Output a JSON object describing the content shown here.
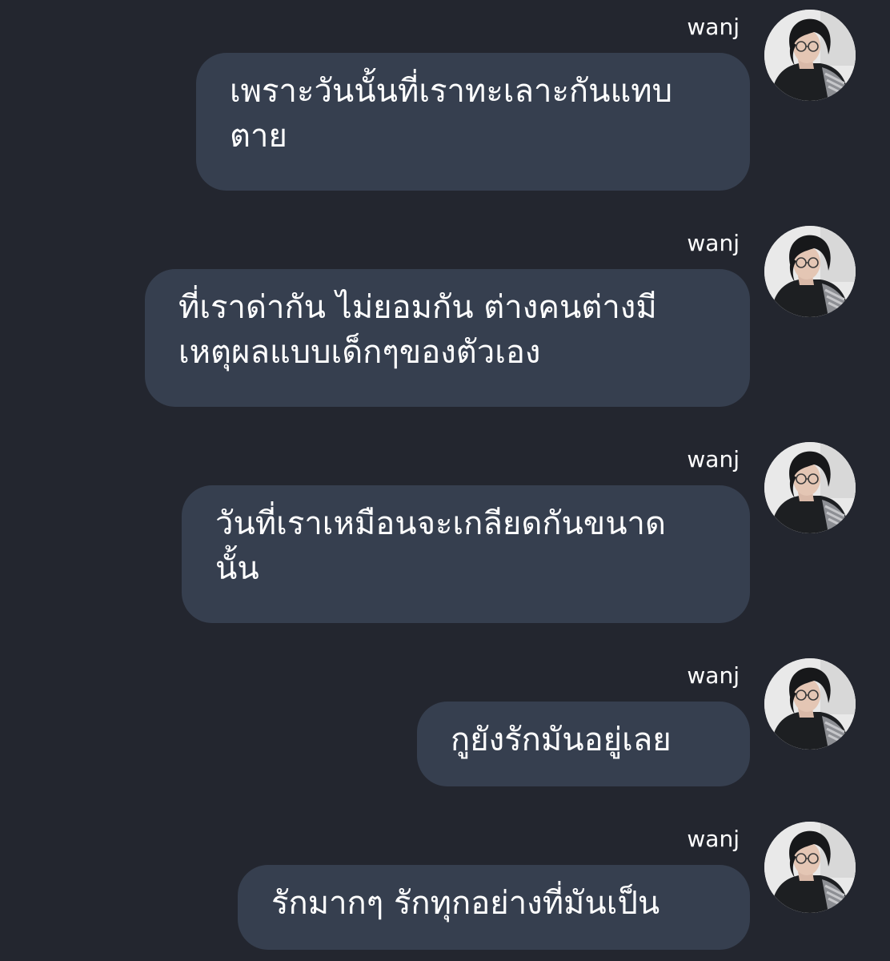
{
  "colors": {
    "background": "#23262f",
    "bubble": "#363f4f",
    "text": "#ffffff"
  },
  "messages": [
    {
      "sender": "wanj",
      "text": "เพราะวันนั้นที่เราทะเลาะกันแทบ\nตาย",
      "avatar_icon": "profile-photo"
    },
    {
      "sender": "wanj",
      "text": "ที่เราด่ากัน ไม่ยอมกัน ต่างคนต่างมี\nเหตุผลแบบเด็กๆของตัวเอง",
      "avatar_icon": "profile-photo"
    },
    {
      "sender": "wanj",
      "text": "วันที่เราเหมือนจะเกลียดกันขนาด\nนั้น",
      "avatar_icon": "profile-photo"
    },
    {
      "sender": "wanj",
      "text": "กูยังรักมันอยู่เลย",
      "avatar_icon": "profile-photo"
    },
    {
      "sender": "wanj",
      "text": "รักมากๆ รักทุกอย่างที่มันเป็น",
      "avatar_icon": "profile-photo"
    }
  ]
}
